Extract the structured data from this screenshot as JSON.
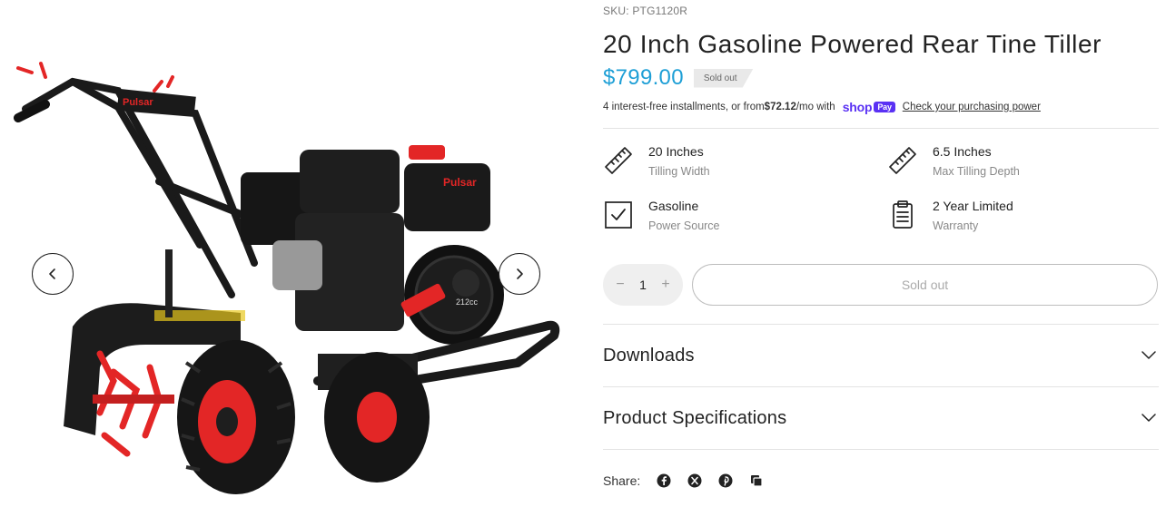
{
  "product": {
    "sku": "SKU: PTG1120R",
    "title": "20 Inch Gasoline Powered Rear Tine Tiller",
    "price": "$799.00",
    "badge": "Sold out",
    "brand_logo": "Pulsar",
    "engine_badge": "212cc"
  },
  "installments": {
    "text_before": "4 interest-free installments, or from ",
    "amount": "$72.12",
    "text_after": "/mo with",
    "shop_word": "shop",
    "pay_word": "Pay",
    "link": "Check your purchasing power"
  },
  "features": [
    {
      "value": "20 Inches",
      "label": "Tilling Width",
      "icon": "ruler-icon"
    },
    {
      "value": "6.5 Inches",
      "label": "Max Tilling Depth",
      "icon": "ruler-icon"
    },
    {
      "value": "Gasoline",
      "label": "Power Source",
      "icon": "checkbox-icon"
    },
    {
      "value": "2 Year Limited",
      "label": "Warranty",
      "icon": "clipboard-icon"
    }
  ],
  "purchase": {
    "quantity": "1",
    "decrement": "−",
    "increment": "+",
    "button_label": "Sold out"
  },
  "accordions": [
    {
      "title": "Downloads"
    },
    {
      "title": "Product Specifications"
    }
  ],
  "share": {
    "label": "Share:",
    "icons": [
      "facebook-icon",
      "x-icon",
      "pinterest-icon",
      "copy-link-icon"
    ]
  },
  "colors": {
    "price": "#1e9fd6",
    "shop_pay": "#5a31f4",
    "tiller_red": "#e32626"
  }
}
